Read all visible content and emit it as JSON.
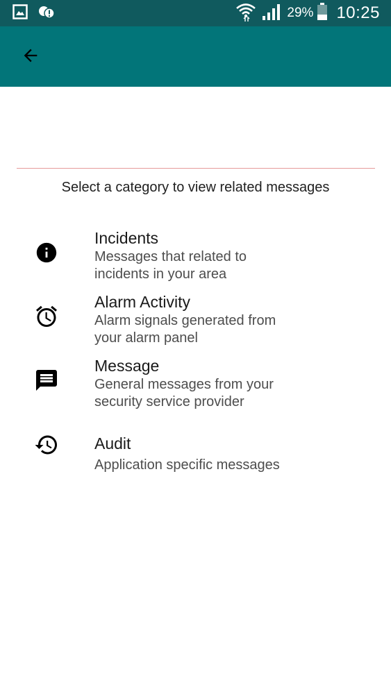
{
  "status_bar": {
    "battery_percent": "29%",
    "time": "10:25",
    "icons": [
      "gallery-icon",
      "alert-cloud-icon",
      "wifi-icon",
      "signal-icon",
      "battery-icon"
    ]
  },
  "app_bar": {
    "back_icon": "arrow-back-icon",
    "color": "#027579",
    "status_color": "#105a5e"
  },
  "instruction": "Select a category to view related messages",
  "categories": [
    {
      "icon": "info-icon",
      "title": "Incidents",
      "desc1": "Messages that related to",
      "desc2": "incidents in your area"
    },
    {
      "icon": "alarm-clock-icon",
      "title": "Alarm Activity",
      "desc1": "Alarm signals generated from",
      "desc2": "your alarm panel"
    },
    {
      "icon": "message-icon",
      "title": "Message",
      "desc1": "General messages from your",
      "desc2": "security service provider"
    },
    {
      "icon": "history-icon",
      "title": "Audit",
      "desc1": "Application specific messages"
    }
  ],
  "divider_color": "#e59a9a"
}
